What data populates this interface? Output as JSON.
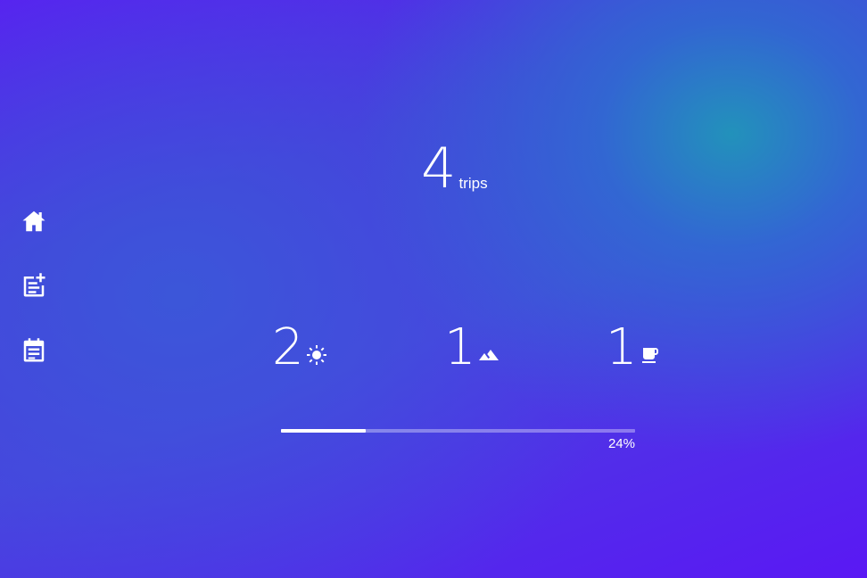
{
  "sidebar": {
    "items": [
      {
        "name": "home",
        "icon": "home-icon"
      },
      {
        "name": "add-trip",
        "icon": "note-add-icon"
      },
      {
        "name": "trips-list",
        "icon": "calendar-note-icon"
      }
    ]
  },
  "summary": {
    "total_count": "4",
    "total_label": "trips"
  },
  "stats": [
    {
      "count": "2",
      "icon": "sun-icon",
      "category": "sunny"
    },
    {
      "count": "1",
      "icon": "mountain-icon",
      "category": "mountain"
    },
    {
      "count": "1",
      "icon": "coffee-icon",
      "category": "cafe"
    }
  ],
  "progress": {
    "value": 0.24,
    "label": "24%"
  },
  "colors": {
    "text": "#ffffff",
    "background_start": "#5a1ef2",
    "background_teal": "#2096b9",
    "track": "rgba(255,255,255,0.35)"
  }
}
